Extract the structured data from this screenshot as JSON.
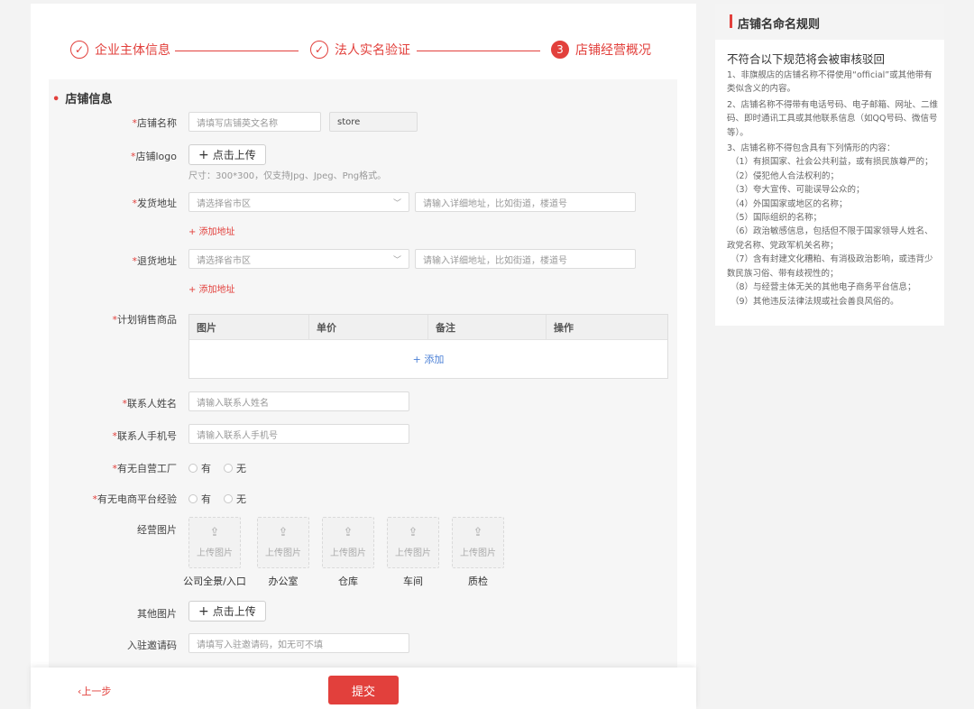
{
  "stepper": {
    "steps": [
      {
        "num": "✓",
        "label": "企业主体信息"
      },
      {
        "num": "✓",
        "label": "法人实名验证"
      },
      {
        "num": "3",
        "label": "店铺经营概况"
      }
    ]
  },
  "form": {
    "section_title": "店铺信息",
    "shop_name": {
      "label": "店铺名称",
      "placeholder": "请填写店铺英文名称",
      "suffix": "store"
    },
    "shop_logo": {
      "label": "店铺logo",
      "upload_label": "点击上传",
      "hint": "尺寸：300*300，仅支持Jpg、Jpeg、Png格式。"
    },
    "ship_address": {
      "label": "发货地址",
      "region_placeholder": "请选择省市区",
      "detail_placeholder": "请输入详细地址，比如街道，楼道号",
      "add_label": "+ 添加地址"
    },
    "return_address": {
      "label": "退货地址",
      "region_placeholder": "请选择省市区",
      "detail_placeholder": "请输入详细地址，比如街道，楼道号",
      "add_label": "+ 添加地址"
    },
    "planned_goods": {
      "label": "计划销售商品",
      "columns": [
        "图片",
        "单价",
        "备注",
        "操作"
      ],
      "add_label": "+ 添加"
    },
    "contact_name": {
      "label": "联系人姓名",
      "placeholder": "请输入联系人姓名"
    },
    "contact_phone": {
      "label": "联系人手机号",
      "placeholder": "请输入联系人手机号"
    },
    "own_factory": {
      "label": "有无自营工厂",
      "options": [
        "有",
        "无"
      ]
    },
    "ecommerce_experience": {
      "label": "有无电商平台经验",
      "options": [
        "有",
        "无"
      ]
    },
    "business_images": {
      "label": "经营图片",
      "upload_text": "上传图片",
      "captions": [
        "公司全景/入口",
        "办公室",
        "仓库",
        "车间",
        "质检"
      ]
    },
    "other_images": {
      "label": "其他图片",
      "upload_label": "点击上传"
    },
    "invite_code": {
      "label": "入驻邀请码",
      "placeholder": "请填写入驻邀请码，如无可不填"
    }
  },
  "footer": {
    "prev_label": "上一步",
    "submit_label": "提交"
  },
  "rules": {
    "title": "店铺名命名规则",
    "subtitle": "不符合以下规范将会被审核驳回",
    "items": [
      "1、非旗舰店的店铺名称不得使用“official”或其他带有类似含义的内容。",
      "2、店铺名称不得带有电话号码、电子邮箱、网址、二维码、即时通讯工具或其他联系信息（如QQ号码、微信号等）。",
      "3、店铺名称不得包含具有下列情形的内容："
    ],
    "subitems": [
      "（1）有损国家、社会公共利益，或有损民族尊严的；",
      "（2）侵犯他人合法权利的；",
      "（3）夸大宣传、可能误导公众的；",
      "（4）外国国家或地区的名称；",
      "（5）国际组织的名称；",
      "（6）政治敏感信息，包括但不限于国家领导人姓名、政党名称、党政军机关名称；",
      "（7）含有封建文化糟粕、有消极政治影响，或违背少数民族习俗、带有歧视性的；",
      "（8）与经营主体无关的其他电子商务平台信息；",
      "（9）其他违反法律法规或社会善良风俗的。"
    ]
  },
  "colors": {
    "accent": "#e2403c",
    "link_blue": "#4a7fd6"
  }
}
